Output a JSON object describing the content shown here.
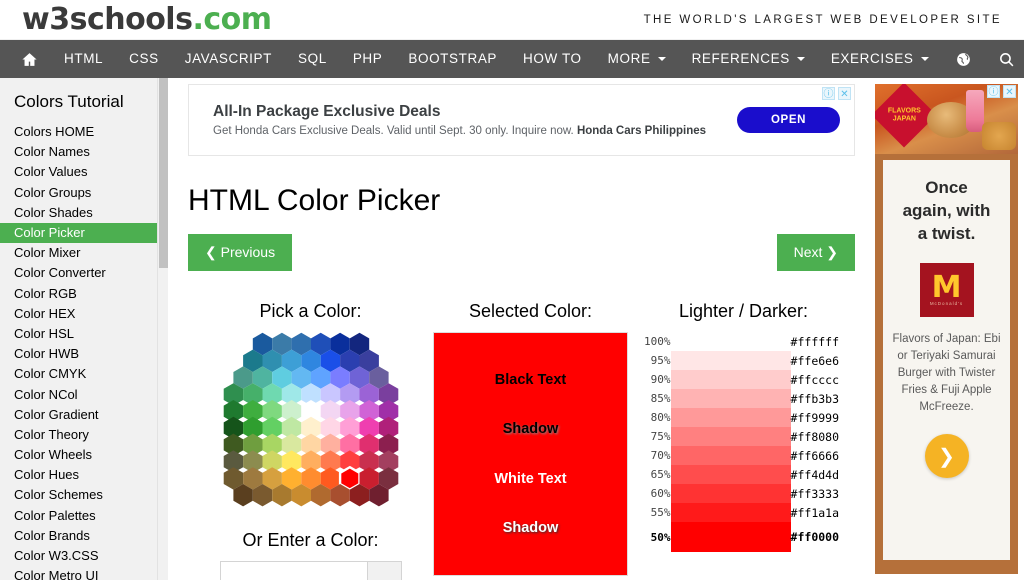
{
  "header": {
    "logo_main": "w3schools",
    "logo_suffix": ".com",
    "tagline": "THE WORLD'S LARGEST WEB DEVELOPER SITE"
  },
  "navbar": {
    "home_icon": "home-icon",
    "globe_icon": "globe-icon",
    "search_icon": "search-icon",
    "items": [
      {
        "label": "HTML",
        "caret": false
      },
      {
        "label": "CSS",
        "caret": false
      },
      {
        "label": "JAVASCRIPT",
        "caret": false
      },
      {
        "label": "SQL",
        "caret": false
      },
      {
        "label": "PHP",
        "caret": false
      },
      {
        "label": "BOOTSTRAP",
        "caret": false
      },
      {
        "label": "HOW TO",
        "caret": false
      },
      {
        "label": "MORE",
        "caret": true
      },
      {
        "label": "REFERENCES",
        "caret": true
      },
      {
        "label": "EXERCISES",
        "caret": true
      }
    ]
  },
  "sidebar": {
    "title": "Colors Tutorial",
    "active_index": 5,
    "items": [
      {
        "label": "Colors HOME"
      },
      {
        "label": "Color Names"
      },
      {
        "label": "Color Values"
      },
      {
        "label": "Color Groups"
      },
      {
        "label": "Color Shades"
      },
      {
        "label": "Color Picker"
      },
      {
        "label": "Color Mixer"
      },
      {
        "label": "Color Converter"
      },
      {
        "label": "Color RGB"
      },
      {
        "label": "Color HEX"
      },
      {
        "label": "Color HSL"
      },
      {
        "label": "Color HWB"
      },
      {
        "label": "Color CMYK"
      },
      {
        "label": "Color NCol"
      },
      {
        "label": "Color Gradient"
      },
      {
        "label": "Color Theory"
      },
      {
        "label": "Color Wheels"
      },
      {
        "label": "Color Hues"
      },
      {
        "label": "Color Schemes"
      },
      {
        "label": "Color Palettes"
      },
      {
        "label": "Color Brands"
      },
      {
        "label": "Color W3.CSS"
      },
      {
        "label": "Color Metro UI"
      }
    ]
  },
  "ad_top": {
    "title": "All-In Package Exclusive Deals",
    "desc": "Get Honda Cars Exclusive Deals. Valid until Sept. 30 only. Inquire now. ",
    "advertiser": "Honda Cars Philippines",
    "button": "OPEN",
    "info_icon": "info-icon",
    "close_icon": "close-icon"
  },
  "main": {
    "page_title": "HTML Color Picker",
    "prev_button": "❮ Previous",
    "next_button": "Next ❯"
  },
  "picker": {
    "pick_heading": "Pick a Color:",
    "enter_heading": "Or Enter a Color:",
    "enter_value": "",
    "enter_placeholder": "",
    "enter_button_label": "",
    "selected_heading": "Selected Color:",
    "selected_color": "#ff0000",
    "selected_labels": {
      "black_text": "Black Text",
      "black_shadow": "Shadow",
      "white_text": "White Text",
      "white_shadow": "Shadow"
    },
    "lighter_heading": "Lighter / Darker:"
  },
  "chart_data": {
    "type": "table",
    "title": "Lighter / Darker:",
    "columns": [
      "percent",
      "swatch",
      "hex"
    ],
    "rows": [
      {
        "percent": "100%",
        "hex": "#ffffff",
        "color": "#ffffff",
        "current": false,
        "blank": true
      },
      {
        "percent": "95%",
        "hex": "#ffe6e6",
        "color": "#ffe6e6",
        "current": false,
        "blank": false
      },
      {
        "percent": "90%",
        "hex": "#ffcccc",
        "color": "#ffcccc",
        "current": false,
        "blank": false
      },
      {
        "percent": "85%",
        "hex": "#ffb3b3",
        "color": "#ffb3b3",
        "current": false,
        "blank": false
      },
      {
        "percent": "80%",
        "hex": "#ff9999",
        "color": "#ff9999",
        "current": false,
        "blank": false
      },
      {
        "percent": "75%",
        "hex": "#ff8080",
        "color": "#ff8080",
        "current": false,
        "blank": false
      },
      {
        "percent": "70%",
        "hex": "#ff6666",
        "color": "#ff6666",
        "current": false,
        "blank": false
      },
      {
        "percent": "65%",
        "hex": "#ff4d4d",
        "color": "#ff4d4d",
        "current": false,
        "blank": false
      },
      {
        "percent": "60%",
        "hex": "#ff3333",
        "color": "#ff3333",
        "current": false,
        "blank": false
      },
      {
        "percent": "55%",
        "hex": "#ff1a1a",
        "color": "#ff1a1a",
        "current": false,
        "blank": false
      },
      {
        "percent": "50%",
        "hex": "#ff0000",
        "color": "#ff0000",
        "current": true,
        "blank": false
      }
    ]
  },
  "color_wheel": {
    "selected_hex": "#ff0000",
    "rows": [
      [
        "#1a5a9e",
        "#3b7ba8",
        "#2f6fae",
        "#1f4fb8",
        "#0a2f9c",
        "#13267e"
      ],
      [
        "#1b7a8c",
        "#2f8fb0",
        "#3d9fd6",
        "#2f86e0",
        "#1a4fe8",
        "#2b3fb0",
        "#3a3f9e"
      ],
      [
        "#4b9a8a",
        "#4fb4a0",
        "#5fcde0",
        "#63b8f2",
        "#5fa3ff",
        "#7a7dff",
        "#6f63d6",
        "#6a5f9e"
      ],
      [
        "#2f8f4f",
        "#46b06a",
        "#6fd9b0",
        "#9fe8e8",
        "#bfe0ff",
        "#c9c6ff",
        "#b39bf2",
        "#9b63d6",
        "#7a3f9e"
      ],
      [
        "#1f7a2f",
        "#3fae3f",
        "#7fd97f",
        "#cdf0cd",
        "#ffffff",
        "#f3d6f3",
        "#e8a3ea",
        "#d063d6",
        "#a02fa8"
      ],
      [
        "#15541a",
        "#2f9e2f",
        "#63d063",
        "#bfe8a3",
        "#fff0cd",
        "#ffd6e6",
        "#ff9fd6",
        "#ef3fb0",
        "#b0207a"
      ],
      [
        "#3f5a20",
        "#6f9e3f",
        "#a8d663",
        "#d9e89f",
        "#ffd6a3",
        "#ffb09f",
        "#ff6fa3",
        "#e02f6f",
        "#8c1f4f"
      ],
      [
        "#5a5a3f",
        "#8c8c4f",
        "#cfd663",
        "#ffe85f",
        "#ffae5f",
        "#ff7a4f",
        "#ff3f3f",
        "#c92f4f",
        "#a33f5f"
      ],
      [
        "#6f5a2f",
        "#9e7a3f",
        "#d6a03f",
        "#ffb02f",
        "#ff8c2f",
        "#ff5a1f",
        "#ff0000",
        "#c91f2f",
        "#7a2f3f"
      ],
      [
        "#5a3f1f",
        "#7a5a2f",
        "#a87a2f",
        "#c98c2f",
        "#b06a2f",
        "#a84f2f",
        "#8c1f1f",
        "#6f1f2f"
      ]
    ]
  }
}
